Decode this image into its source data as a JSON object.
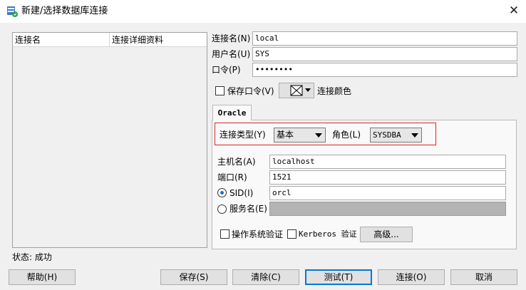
{
  "window": {
    "title": "新建/选择数据库连接"
  },
  "connection_list": {
    "columns": [
      "连接名",
      "连接详细资料"
    ]
  },
  "form": {
    "conn_name_label": "连接名(N)",
    "conn_name_value": "local",
    "username_label": "用户名(U)",
    "username_value": "SYS",
    "password_label": "口令(P)",
    "password_value": "••••••••",
    "save_password_label": "保存口令(V)",
    "conn_color_label": "连接颜色"
  },
  "tabs": [
    {
      "label": "Oracle"
    }
  ],
  "oracle": {
    "conn_type_label": "连接类型(Y)",
    "conn_type_value": "基本",
    "role_label": "角色(L)",
    "role_value": "SYSDBA",
    "host_label": "主机名(A)",
    "host_value": "localhost",
    "port_label": "端口(R)",
    "port_value": "1521",
    "sid_label": "SID(I)",
    "sid_value": "orcl",
    "service_label": "服务名(E)",
    "service_value": "",
    "os_auth_label": "操作系统验证",
    "kerberos_label": "Kerberos 验证",
    "advanced_label": "高级..."
  },
  "status": {
    "text": "状态: 成功"
  },
  "buttons": {
    "help": "帮助(H)",
    "save": "保存(S)",
    "clear": "清除(C)",
    "test": "测试(T)",
    "connect": "连接(O)",
    "cancel": "取消"
  }
}
